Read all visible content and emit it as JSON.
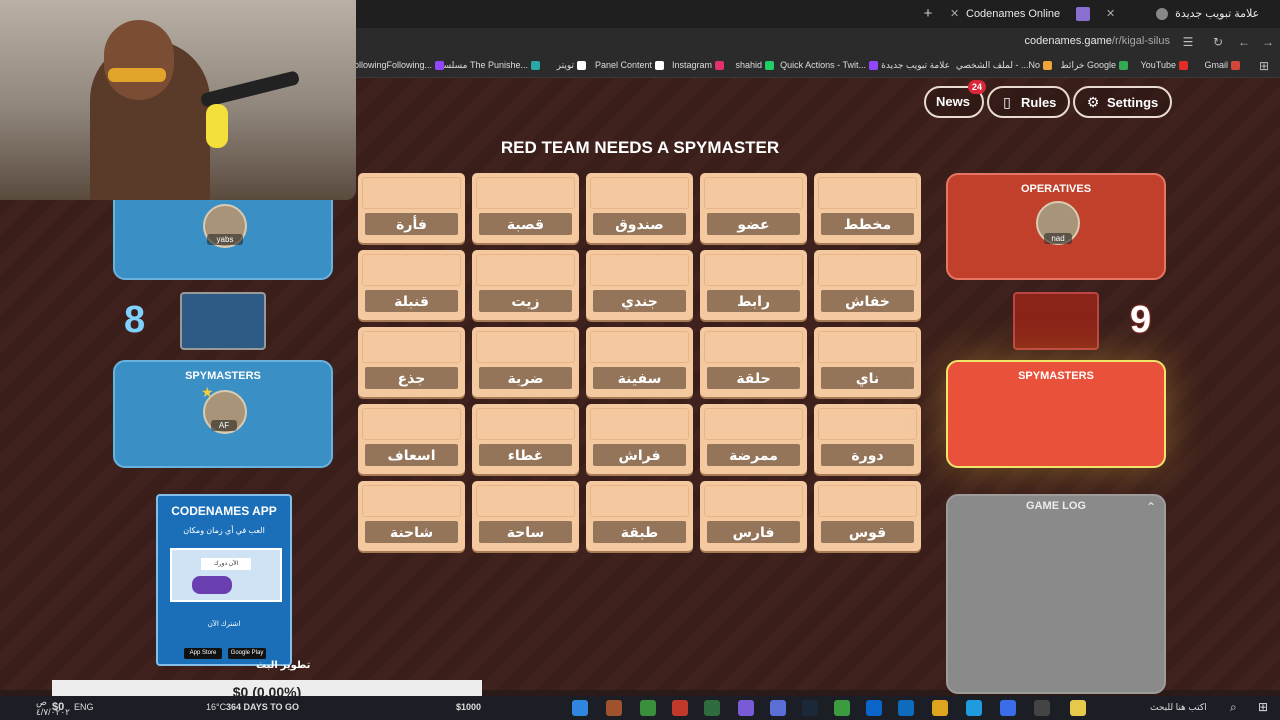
{
  "browser": {
    "tabs": [
      {
        "label": "Codenames Online",
        "close": "✕"
      },
      {
        "label": "علامة تبويب جديدة",
        "close": "✕"
      }
    ],
    "newtab": "+",
    "url_host": "codenames.game",
    "url_path": "/r/kigal-silus",
    "bookmarks": [
      {
        "label": "Gmail",
        "color": "#d44638"
      },
      {
        "label": "YouTube",
        "color": "#e52d27"
      },
      {
        "label": "خرائط Google",
        "color": "#34a853"
      },
      {
        "label": "لملف الشخصي - ...No",
        "color": "#f2a33a"
      },
      {
        "label": "علامة تبويب جديدة",
        "color": "#888888"
      },
      {
        "label": "Quick Actions - Twit...",
        "color": "#9146ff"
      },
      {
        "label": "shahid",
        "color": "#1fcf65"
      },
      {
        "label": "Instagram",
        "color": "#e1306c"
      },
      {
        "label": "Panel Content",
        "color": "#ffffff"
      },
      {
        "label": "تويتر",
        "color": "#ffffff"
      },
      {
        "label": "مسلسل The Punishe...",
        "color": "#2aa7a7"
      },
      {
        "label": "FollowingFollowing...",
        "color": "#9146ff"
      }
    ]
  },
  "header": {
    "news_label": "News",
    "news_badge": "24",
    "rules_label": "Rules",
    "settings_label": "Settings"
  },
  "headline": "RED TEAM NEEDS A SPYMASTER",
  "board": [
    [
      "مخطط",
      "عضو",
      "صندوق",
      "قصبة",
      "فأرة"
    ],
    [
      "خفاش",
      "رابط",
      "جندي",
      "زيت",
      "قنبلة"
    ],
    [
      "ناي",
      "حلقة",
      "سفينة",
      "ضربة",
      "جذع"
    ],
    [
      "دورة",
      "ممرضة",
      "فراش",
      "غطاء",
      "اسعاف"
    ],
    [
      "قوس",
      "فارس",
      "طبقة",
      "ساحة",
      "شاحنة"
    ]
  ],
  "blue_team": {
    "score": "8",
    "operatives_player": "yabs",
    "spymasters_title": "SPYMASTERS",
    "spymaster_player": "AF"
  },
  "red_team": {
    "score": "9",
    "operatives_title": "OPERATIVES",
    "operative_player": "nad",
    "spymasters_title": "SPYMASTERS"
  },
  "game_log": {
    "title": "GAME LOG",
    "toggle": "⌃"
  },
  "app_promo": {
    "title": "CODENAMES APP",
    "tagline": "العب في أي زمان ومكان",
    "cta": "اشترك الآن",
    "screenshot_text": "الآن دورك",
    "appstore": "App Store",
    "googleplay": "Google Play",
    "caption": "تطوير البث"
  },
  "stream": {
    "amount": "$0 (0.00%)",
    "left_value": "$0",
    "days": "364 DAYS TO GO",
    "goal": "$1000"
  },
  "taskbar": {
    "search_placeholder": "اكتب هنا للبحث",
    "lang": "ENG",
    "temp": "16°C",
    "weather": "أمطار خفيفة",
    "time": "ص",
    "date": "٤/٧/٠٢٠٢"
  }
}
